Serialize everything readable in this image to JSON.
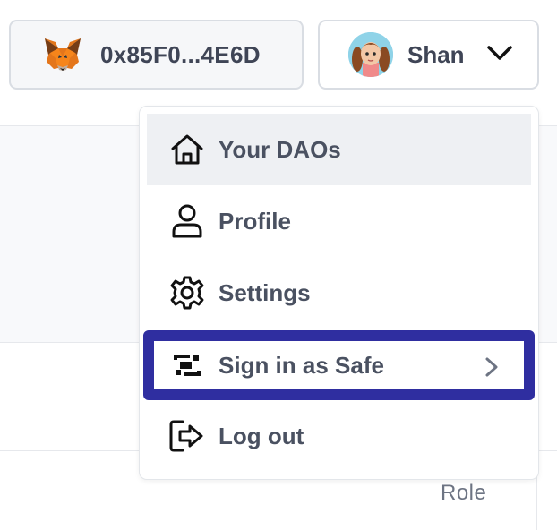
{
  "header": {
    "wallet": {
      "address": "0x85F0...4E6D",
      "icon": "metamask-fox-icon"
    },
    "user": {
      "name": "Shan",
      "avatar": "avatar",
      "dropdown_icon": "chevron-down-icon"
    }
  },
  "menu": {
    "items": [
      {
        "label": "Your DAOs",
        "icon": "home-icon",
        "active": true
      },
      {
        "label": "Profile",
        "icon": "user-icon"
      },
      {
        "label": "Settings",
        "icon": "gear-icon"
      },
      {
        "label": "Sign in as Safe",
        "icon": "safe-icon",
        "submenu_icon": "chevron-right-icon",
        "highlighted": true
      },
      {
        "label": "Log out",
        "icon": "logout-icon"
      }
    ]
  },
  "background": {
    "column_label": "Role"
  },
  "colors": {
    "highlight_border": "#2f2ea0",
    "active_item_bg": "#eef0f3",
    "text": "#4a5161"
  }
}
